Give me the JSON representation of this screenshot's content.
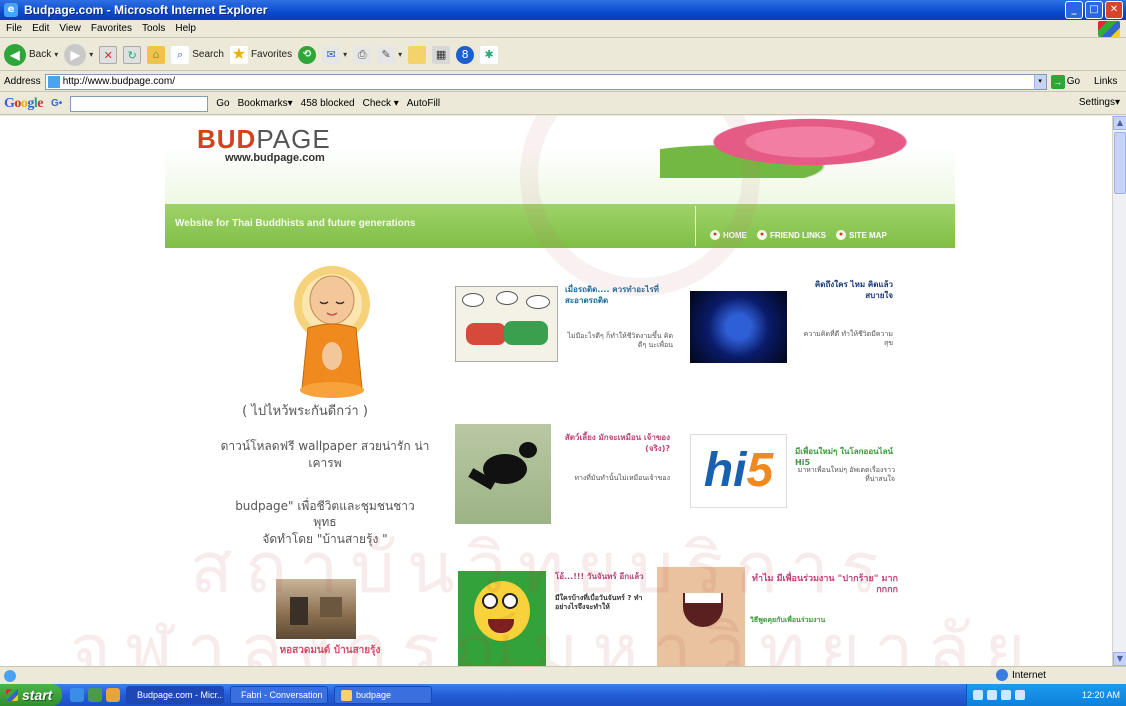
{
  "window": {
    "title": "Budpage.com - Microsoft Internet Explorer"
  },
  "menu": [
    "File",
    "Edit",
    "View",
    "Favorites",
    "Tools",
    "Help"
  ],
  "toolbar": {
    "back": "Back",
    "search": "Search",
    "favorites": "Favorites"
  },
  "address": {
    "label": "Address",
    "url": "http://www.budpage.com/",
    "go": "Go",
    "links": "Links"
  },
  "google_bar": {
    "logo": "Google",
    "g_button": "G•",
    "go_label": "Go",
    "bookmarks": "Bookmarks▾",
    "blocked": "458 blocked",
    "check": "Check ▾",
    "autofill": "AutoFill",
    "settings": "Settings▾"
  },
  "page": {
    "logo_bud": "BUD",
    "logo_page": "PAGE",
    "logo_url": "www.budpage.com",
    "tagline": "Website for Thai Buddhists and future generations",
    "nav": [
      {
        "label": "HOME"
      },
      {
        "label": "FRIEND LINKS"
      },
      {
        "label": "SITE MAP"
      }
    ],
    "monk_caption": "( ไปไหว้พระกันดีกว่า )",
    "download_text": "ดาวน์โหลดฟรี wallpaper สวยน่ารัก น่าเคารพ",
    "mission_text": "budpage\" เพื่อชีวิตและชุมชนชาวพุทธ",
    "organizer_text": "จัดทำโดย \"บ้านสายรุ้ง \"",
    "cards": [
      {
        "title": "เมื่อรถติด.... ควรทำอะไรที่สะอาดรถติด",
        "body": "ไม่มีอะไรดีๆ ก็ทำให้ชีวิตงามขึ้น คิดดีๆ นะเพื่อน"
      },
      {
        "title": "คิดถึงใคร ไหม คิดแล้วสบายใจ",
        "body": "ความคิดที่ดี ทำให้ชีวิตมีความสุข"
      },
      {
        "title": "สัตว์เลี้ยง มักจะเหมือน เจ้าของ (จริง)?",
        "body": "ทางที่มันทำนั้นไม่เหมือนเจ้าของ"
      },
      {
        "title": "มีเพื่อนใหม่ๆ ในโลกออนไลน์ Hi5",
        "body": "มาหาเพื่อนใหม่ๆ อัพเดตเรื่องราวที่น่าสนใจ"
      },
      {
        "title": "โอ้...!!! วันจันทร์ อีกแล้ว",
        "body": "มีใครบ้างที่เบื่อวันจันทร์ ? ทำอย่างไรจึงจะทำให้"
      },
      {
        "title": "ทำไม มีเพื่อนร่วมงาน \"ปากร้าย\" มาก กกกก",
        "body": "วิธีพูดคุยกับเพื่อนร่วมงาน"
      }
    ],
    "bottom_caption": "หอสวดมนต์ บ้านสายรุ้ง"
  },
  "watermark": {
    "line1": "สถาบันวิทยบริการ",
    "line2": "จุฬาลงกรณ์มหาวิทยาลัย"
  },
  "status": {
    "zone": "Internet"
  },
  "taskbar": {
    "start": "start",
    "tasks": [
      {
        "label": "Budpage.com - Micr..."
      },
      {
        "label": "Fabri - Conversation"
      },
      {
        "label": "budpage"
      }
    ],
    "clock": "12:20 AM"
  },
  "colors": {
    "accent_green": "#8cc653",
    "logo_red": "#d2421e",
    "title_blue": "#0a4bd0"
  }
}
